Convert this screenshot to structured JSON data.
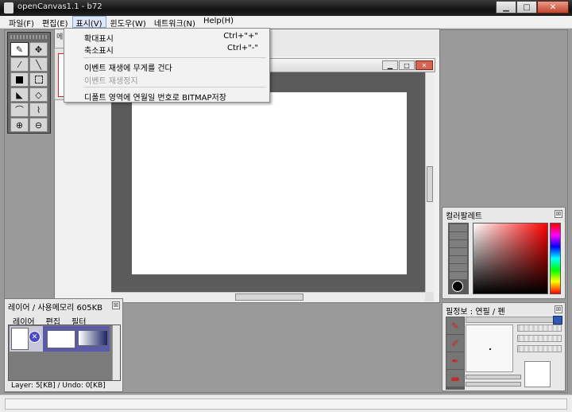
{
  "window": {
    "title": "openCanvas1.1 - b72",
    "min_glyph": "▁",
    "max_glyph": "□",
    "close_glyph": "✕"
  },
  "menubar": {
    "items": [
      "파일(F)",
      "편집(E)",
      "표시(V)",
      "윈도우(W)",
      "네트워크(N)",
      "Help(H)"
    ]
  },
  "document": {
    "tab_fragment": "메",
    "inner_controls": {
      "min": "▁",
      "max": "□",
      "close": "✕"
    }
  },
  "view_menu": {
    "items": [
      {
        "label": "확대표시",
        "shortcut": "Ctrl+\"+\""
      },
      {
        "label": "축소표시",
        "shortcut": "Ctrl+\"-\""
      },
      {
        "label": "이벤트 재생에 무게를 건다",
        "shortcut": ""
      },
      {
        "label": "이벤트 재생정지",
        "shortcut": "",
        "disabled": true
      },
      {
        "label": "디폴트 영역에 연월일 번호로 BITMAP저장",
        "shortcut": ""
      }
    ]
  },
  "color_palette": {
    "title": "컬러팔레트",
    "close_glyph": "☒"
  },
  "brush_info": {
    "title": "필정보 : 연필  /  펜",
    "close_glyph": "☒"
  },
  "layer_panel": {
    "title": "레이어 / 사용메모리 605KB",
    "close_glyph": "☒",
    "menu": [
      "레이어",
      "편집",
      "필터"
    ],
    "status": "Layer: 5[KB] / Undo: 0[KB]"
  },
  "icons": {
    "pencil": "pencil-icon",
    "move": "move-icon",
    "eyedropper": "eyedropper-icon",
    "line": "line-icon"
  }
}
